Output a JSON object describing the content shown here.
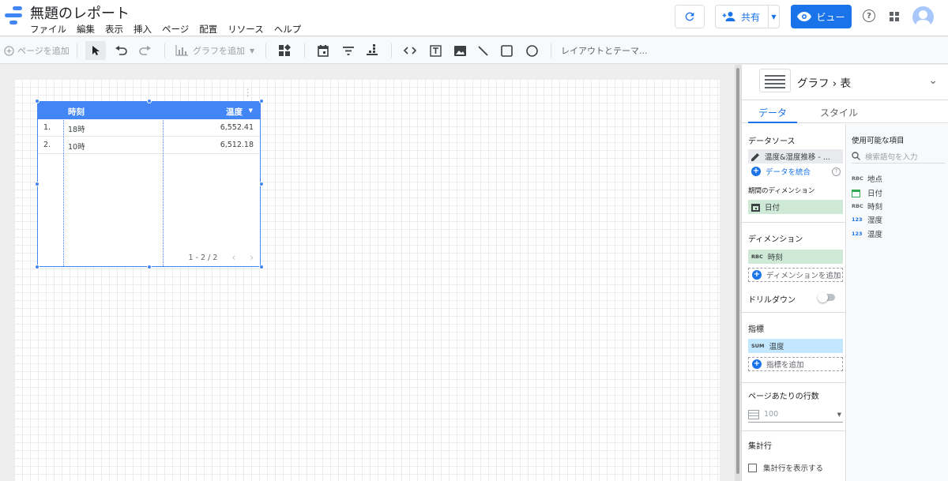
{
  "app": {
    "title": "無題のレポート"
  },
  "menu": [
    "ファイル",
    "編集",
    "表示",
    "挿入",
    "ページ",
    "配置",
    "リソース",
    "ヘルプ"
  ],
  "header": {
    "share_label": "共有",
    "view_label": "ビュー",
    "help_label": "?"
  },
  "toolbar": {
    "add_page": "ページを追加",
    "add_chart": "グラフを追加",
    "layout_theme": "レイアウトとテーマ..."
  },
  "table": {
    "columns": [
      "時刻",
      "温度"
    ],
    "rows": [
      {
        "num": "1.",
        "dim": "18時",
        "val": "6,552.41"
      },
      {
        "num": "2.",
        "dim": "10時",
        "val": "6,512.18"
      }
    ],
    "pager": "1 - 2 / 2"
  },
  "panel": {
    "title": "グラフ › 表",
    "tabs": {
      "data": "データ",
      "style": "スタイル"
    },
    "data_source_title": "データソース",
    "data_source": "温度&湿度推移 - ...",
    "blend": "データを統合",
    "date_dim_title": "期間のディメンション",
    "date_dim": "日付",
    "dimension_title": "ディメンション",
    "dimension": "時刻",
    "add_dimension": "ディメンションを追加",
    "drilldown": "ドリルダウン",
    "metric_title": "指標",
    "metric": "温度",
    "metric_agg": "SUM",
    "add_metric": "指標を追加",
    "rows_per_page_title": "ページあたりの行数",
    "rows_per_page": "100",
    "summary_title": "集計行",
    "summary_check": "集計行を表示する"
  },
  "fields": {
    "title": "使用可能な項目",
    "search_placeholder": "検索語句を入力",
    "items": [
      {
        "type": "RBC",
        "name": "地点"
      },
      {
        "type": "date",
        "name": "日付"
      },
      {
        "type": "RBC",
        "name": "時刻"
      },
      {
        "type": "123",
        "name": "湿度"
      },
      {
        "type": "123",
        "name": "温度"
      }
    ]
  },
  "colors": {
    "accent": "#1a73e8",
    "table_header": "#4285f4",
    "dim_chip": "#ceead6",
    "metric_chip": "#c2e7ff"
  }
}
